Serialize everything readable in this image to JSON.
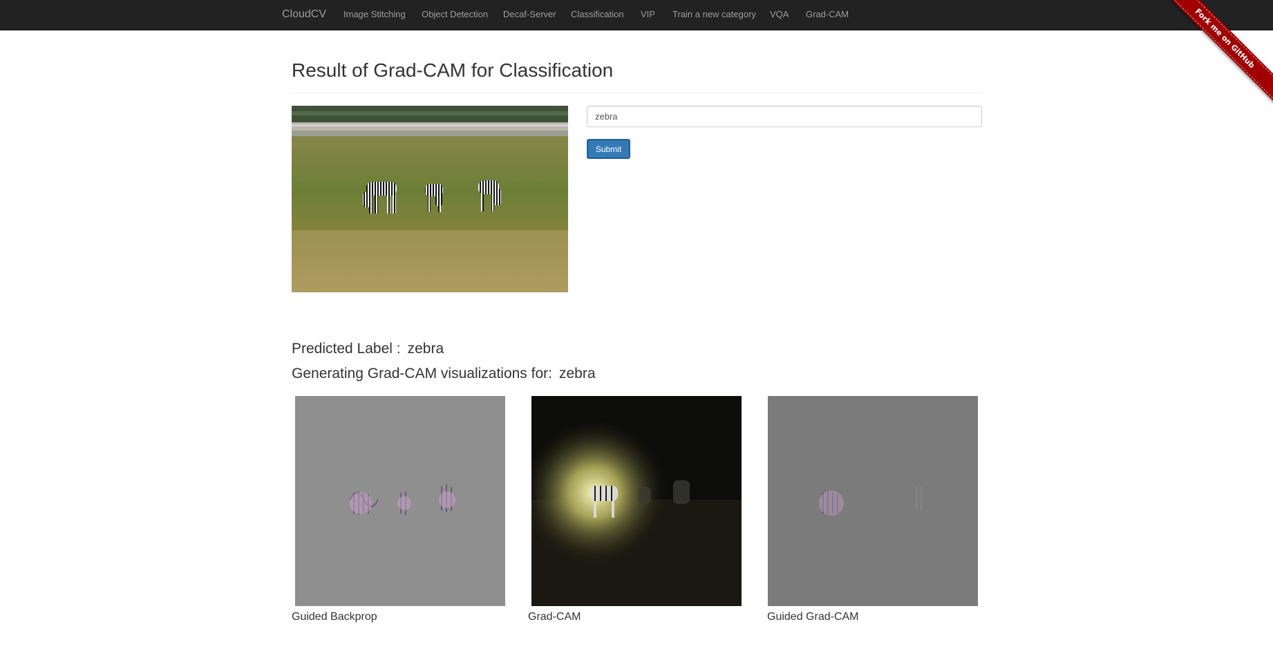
{
  "navbar": {
    "brand": "CloudCV",
    "items": [
      {
        "label": "Image Stitching"
      },
      {
        "label": "Object Detection"
      },
      {
        "label": "Decaf-Server"
      },
      {
        "label": "Classification"
      },
      {
        "label": "VIP"
      },
      {
        "label": "Train a new category"
      },
      {
        "label": "VQA"
      },
      {
        "label": "Grad-CAM"
      }
    ]
  },
  "ribbon": {
    "label": "Fork me on GitHub"
  },
  "page": {
    "title": "Result of Grad-CAM for Classification"
  },
  "form": {
    "input_value": "zebra",
    "submit_label": "Submit"
  },
  "result": {
    "predicted_prefix": "Predicted Label :",
    "predicted_value": "zebra",
    "generating_prefix": "Generating Grad-CAM visualizations for:",
    "generating_value": "zebra"
  },
  "visualizations": [
    {
      "caption": "Guided Backprop"
    },
    {
      "caption": "Grad-CAM"
    },
    {
      "caption": "Guided Grad-CAM"
    }
  ]
}
